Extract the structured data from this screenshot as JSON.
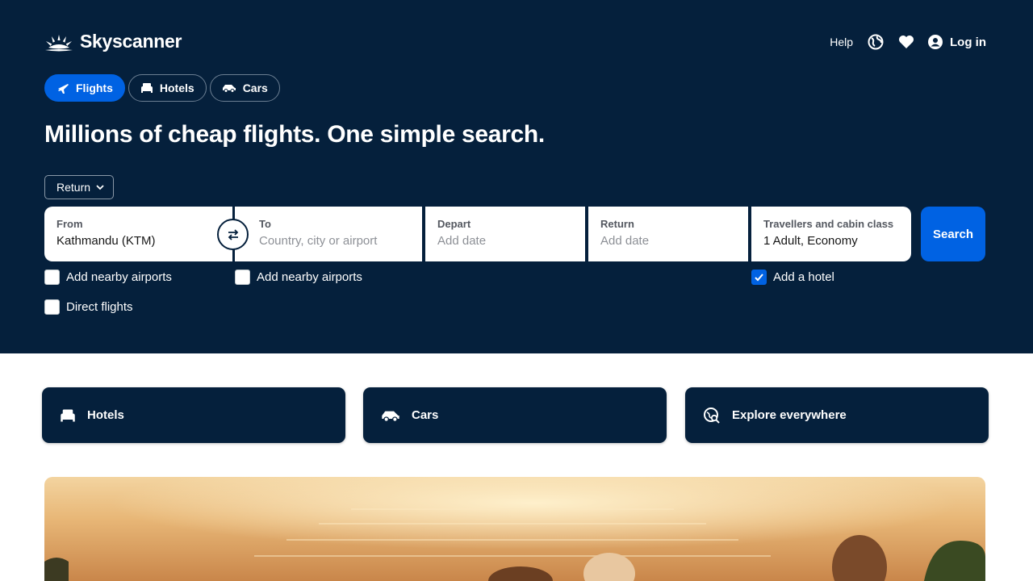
{
  "brand": {
    "name": "Skyscanner"
  },
  "topnav": {
    "help": "Help",
    "login": "Log in"
  },
  "tabs": [
    {
      "label": "Flights",
      "active": true
    },
    {
      "label": "Hotels",
      "active": false
    },
    {
      "label": "Cars",
      "active": false
    }
  ],
  "headline": "Millions of cheap flights. One simple search.",
  "trip_type": "Return",
  "search": {
    "from": {
      "label": "From",
      "value": "Kathmandu (KTM)"
    },
    "to": {
      "label": "To",
      "placeholder": "Country, city or airport"
    },
    "depart": {
      "label": "Depart",
      "placeholder": "Add date"
    },
    "return": {
      "label": "Return",
      "placeholder": "Add date"
    },
    "travellers": {
      "label": "Travellers and cabin class",
      "value": "1 Adult, Economy"
    },
    "button": "Search"
  },
  "options": {
    "nearby_from": {
      "label": "Add nearby airports",
      "checked": false
    },
    "nearby_to": {
      "label": "Add nearby airports",
      "checked": false
    },
    "add_hotel": {
      "label": "Add a hotel",
      "checked": true
    },
    "direct": {
      "label": "Direct flights",
      "checked": false
    }
  },
  "quicklinks": [
    {
      "label": "Hotels",
      "icon": "bed-icon"
    },
    {
      "label": "Cars",
      "icon": "car-icon"
    },
    {
      "label": "Explore everywhere",
      "icon": "explore-icon"
    }
  ],
  "colors": {
    "navy": "#05203c",
    "accent": "#0062e3"
  }
}
